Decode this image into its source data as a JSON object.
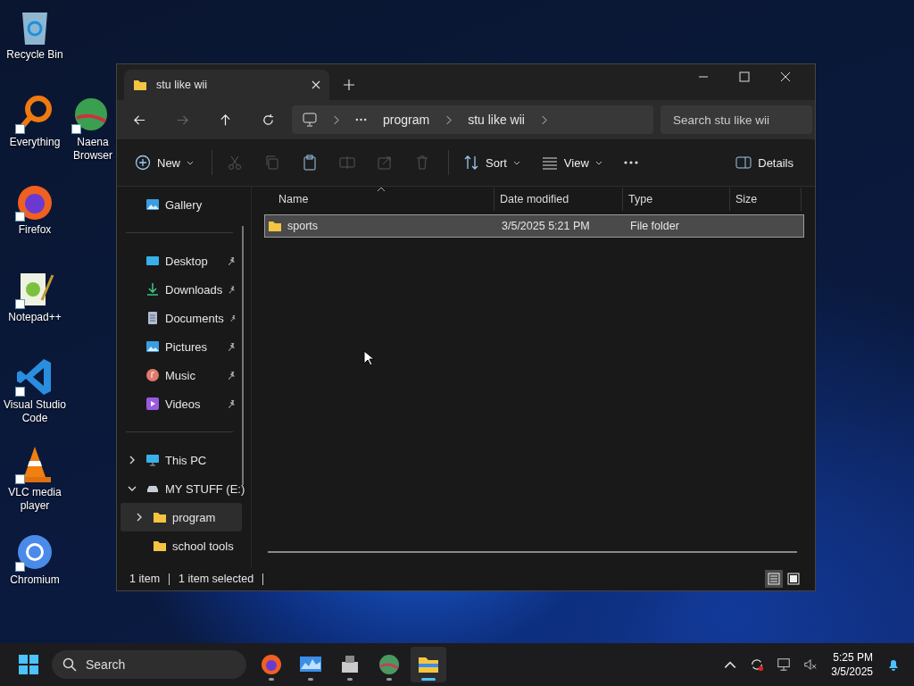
{
  "desktop_icons": [
    {
      "label": "Recycle Bin",
      "kind": "recycle",
      "shortcut": false
    },
    {
      "label": "Everything",
      "kind": "everything",
      "shortcut": true
    },
    {
      "label": "Firefox",
      "kind": "firefox",
      "shortcut": true
    },
    {
      "label": "Notepad++",
      "kind": "notepad",
      "shortcut": true
    },
    {
      "label": "Visual Studio Code",
      "kind": "vscode",
      "shortcut": true
    },
    {
      "label": "VLC media player",
      "kind": "vlc",
      "shortcut": true
    },
    {
      "label": "Chromium",
      "kind": "chromium",
      "shortcut": true
    }
  ],
  "desktop_icons_column_2": [
    {
      "label": "Naena Browser",
      "kind": "globe",
      "shortcut": true
    }
  ],
  "window": {
    "tab": {
      "title": "stu like wii"
    },
    "nav": [
      {
        "kind": "back",
        "disabled": false
      },
      {
        "kind": "forward",
        "disabled": true
      },
      {
        "kind": "up",
        "disabled": false
      },
      {
        "kind": "refresh",
        "disabled": false
      }
    ],
    "breadcrumb": [
      "program",
      "stu like wii"
    ],
    "search": {
      "placeholder": "Search stu like wii"
    },
    "toolbar": [
      {
        "kind": "new",
        "label": "New",
        "disabled": false
      },
      {
        "kind": "cut",
        "disabled": true
      },
      {
        "kind": "copy",
        "disabled": true
      },
      {
        "kind": "paste",
        "disabled": false
      },
      {
        "kind": "rename",
        "disabled": true
      },
      {
        "kind": "share",
        "disabled": true
      },
      {
        "kind": "delete",
        "disabled": true
      },
      {
        "kind": "sort",
        "label": "Sort",
        "disabled": false
      },
      {
        "kind": "view",
        "label": "View",
        "disabled": false
      },
      {
        "kind": "more",
        "disabled": false
      }
    ],
    "details_button": {
      "label": "Details"
    },
    "sidebar": {
      "top": [
        {
          "label": "Gallery",
          "kind": "gallery"
        }
      ],
      "quick_access": [
        {
          "label": "Desktop",
          "kind": "desktop",
          "pinned": true
        },
        {
          "label": "Downloads",
          "kind": "downloads",
          "pinned": true
        },
        {
          "label": "Documents",
          "kind": "documents",
          "pinned": true
        },
        {
          "label": "Pictures",
          "kind": "pictures",
          "pinned": true
        },
        {
          "label": "Music",
          "kind": "music",
          "pinned": true
        },
        {
          "label": "Videos",
          "kind": "videos",
          "pinned": true
        }
      ],
      "tree": [
        {
          "label": "This PC",
          "kind": "pc",
          "expanded": false,
          "selected": false
        },
        {
          "label": "MY STUFF (E:)",
          "kind": "drive",
          "expanded": true,
          "selected": false,
          "children": [
            {
              "label": "program",
              "kind": "folder",
              "expanded": false,
              "has_children": true,
              "selected": true
            },
            {
              "label": "school tools",
              "kind": "folder",
              "has_children": false,
              "selected": false
            }
          ]
        }
      ]
    },
    "table": {
      "columns": [
        "Name",
        "Date modified",
        "Type",
        "Size"
      ],
      "rows": [
        {
          "name": "sports",
          "date_modified": "3/5/2025 5:21 PM",
          "type": "File folder",
          "selected": true
        }
      ]
    },
    "status_bar": {
      "count": "1 item",
      "selection": "1 item selected"
    },
    "view_modes": [
      {
        "kind": "details",
        "selected": true
      },
      {
        "kind": "tiles",
        "selected": false
      }
    ]
  },
  "taskbar": {
    "search": {
      "placeholder": "Search"
    },
    "apps": [
      {
        "kind": "firefox",
        "running": true,
        "active": false
      },
      {
        "kind": "monitor",
        "running": true,
        "active": false
      },
      {
        "kind": "tool",
        "running": true,
        "active": false
      },
      {
        "kind": "globe",
        "running": true,
        "active": false
      },
      {
        "kind": "explorer",
        "running": true,
        "active": true
      }
    ],
    "time": "5:25 PM",
    "date": "3/5/2025"
  }
}
